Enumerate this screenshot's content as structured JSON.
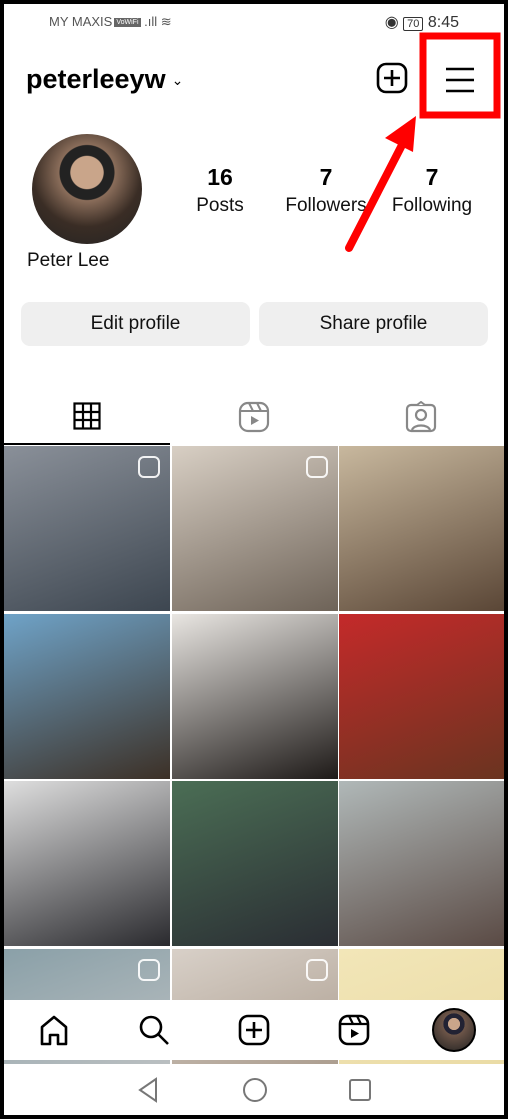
{
  "status_bar": {
    "carrier": "MY MAXIS",
    "vowifi": "VoWiFi",
    "battery": "70",
    "time": "8:45"
  },
  "header": {
    "username": "peterleeyw",
    "create_icon": "plus-square-icon",
    "menu_icon": "hamburger-menu-icon"
  },
  "profile": {
    "name": "Peter Lee",
    "stats": [
      {
        "value": "16",
        "label": "Posts"
      },
      {
        "value": "7",
        "label": "Followers"
      },
      {
        "value": "7",
        "label": "Following"
      }
    ]
  },
  "buttons": {
    "edit": "Edit profile",
    "share": "Share profile"
  },
  "tabs": [
    {
      "icon": "grid-icon",
      "active": true
    },
    {
      "icon": "reels-icon",
      "active": false
    },
    {
      "icon": "tagged-icon",
      "active": false
    }
  ],
  "posts": [
    {
      "colors": [
        "#8a9099",
        "#3d4650"
      ],
      "reel": true
    },
    {
      "colors": [
        "#d8cfc4",
        "#6e6358"
      ],
      "reel": true
    },
    {
      "colors": [
        "#c8b89e",
        "#5a4636"
      ],
      "reel": false
    },
    {
      "colors": [
        "#6fa3c8",
        "#3c3026"
      ],
      "reel": false
    },
    {
      "colors": [
        "#e9e6e2",
        "#1e1a18"
      ],
      "reel": false
    },
    {
      "colors": [
        "#c42a2a",
        "#6a3420"
      ],
      "reel": false
    },
    {
      "colors": [
        "#dedede",
        "#2a2a2e"
      ],
      "reel": false
    },
    {
      "colors": [
        "#4b6e55",
        "#2a2d33"
      ],
      "reel": false
    },
    {
      "colors": [
        "#b0b8b8",
        "#5a4a44"
      ],
      "reel": false
    },
    {
      "colors": [
        "#8aa0a8",
        "#c8c8c8"
      ],
      "reel": true
    },
    {
      "colors": [
        "#d8d0c8",
        "#a09080"
      ],
      "reel": true
    },
    {
      "colors": [
        "#f2e6b8",
        "#e8d8a0"
      ],
      "reel": false
    }
  ],
  "bottom_nav": [
    "home-icon",
    "search-icon",
    "create-icon",
    "reels-icon",
    "profile-avatar"
  ],
  "annotation": {
    "color": "#ff0000"
  }
}
